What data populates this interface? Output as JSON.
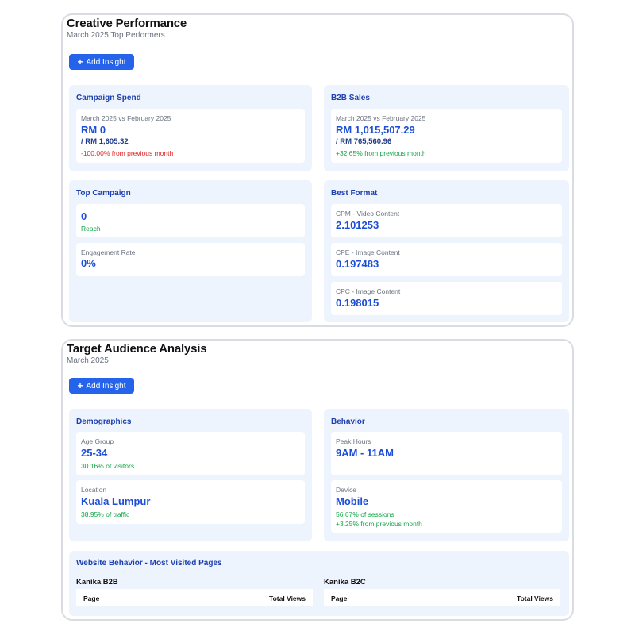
{
  "creative": {
    "title": "Creative Performance",
    "subtitle": "March 2025 Top Performers",
    "add_insight": "Add Insight",
    "campaign_spend": {
      "title": "Campaign Spend",
      "label": "March 2025 vs February 2025",
      "value": "RM 0",
      "previous": "/ RM 1,605.32",
      "change": "-100.00% from previous month"
    },
    "b2b_sales": {
      "title": "B2B Sales",
      "label": "March 2025 vs February 2025",
      "value": "RM 1,015,507.29",
      "previous": "/ RM 765,560.96",
      "change": "+32.65% from previous month"
    },
    "top_campaign": {
      "title": "Top Campaign",
      "reach_value": "0",
      "reach_label": "Reach",
      "engagement_label": "Engagement Rate",
      "engagement_value": "0%"
    },
    "best_format": {
      "title": "Best Format",
      "items": [
        {
          "label": "CPM - Video Content",
          "value": "2.101253"
        },
        {
          "label": "CPE - Image Content",
          "value": "0.197483"
        },
        {
          "label": "CPC - Image Content",
          "value": "0.198015"
        }
      ]
    }
  },
  "audience": {
    "title": "Target Audience Analysis",
    "subtitle": "March 2025",
    "add_insight": "Add Insight",
    "demographics": {
      "title": "Demographics",
      "age_label": "Age Group",
      "age_value": "25-34",
      "age_note": "30.16% of visitors",
      "location_label": "Location",
      "location_value": "Kuala Lumpur",
      "location_note": "38.95% of traffic"
    },
    "behavior": {
      "title": "Behavior",
      "peak_label": "Peak Hours",
      "peak_value": "9AM - 11AM",
      "device_label": "Device",
      "device_value": "Mobile",
      "device_note": "56.67% of sessions",
      "device_change": "+3.25% from previous month"
    },
    "website": {
      "title": "Website Behavior - Most Visited Pages",
      "tables": [
        {
          "name": "Kanika B2B",
          "col_page": "Page",
          "col_views": "Total Views"
        },
        {
          "name": "Kanika B2C",
          "col_page": "Page",
          "col_views": "Total Views"
        }
      ]
    }
  },
  "colors": {
    "accent": "#2563eb",
    "panel_bg": "#eef4fd",
    "value_blue": "#1d4ed8",
    "negative": "#dc2626",
    "positive": "#16a34a"
  }
}
